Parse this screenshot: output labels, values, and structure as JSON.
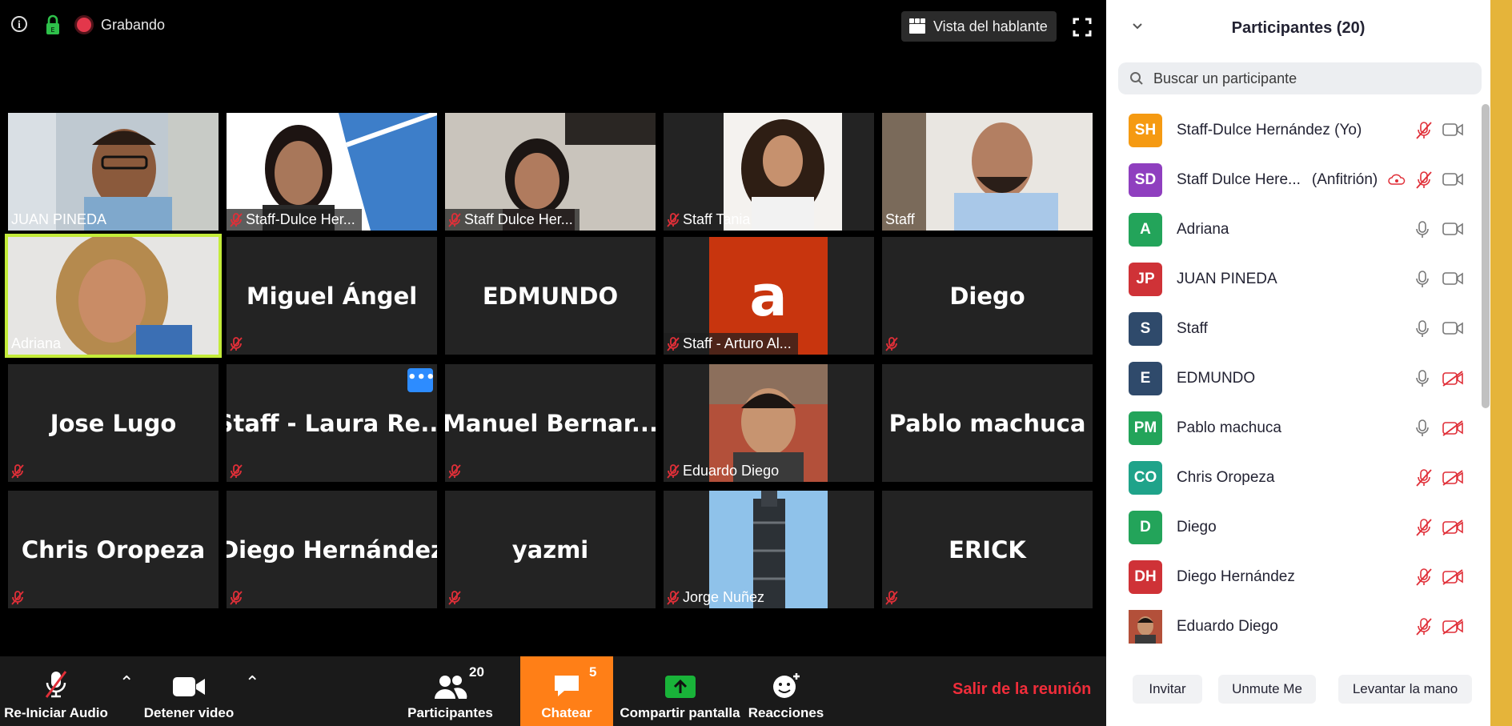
{
  "topbar": {
    "recording_label": "Grabando",
    "view_label": "Vista del hablante"
  },
  "tiles": [
    {
      "name": "JUAN PINEDA",
      "video": true,
      "muted": false
    },
    {
      "name": "Staff-Dulce Her...",
      "video": true,
      "muted": true
    },
    {
      "name": "Staff Dulce Her...",
      "video": true,
      "muted": true
    },
    {
      "name": "Staff Tania",
      "video": true,
      "muted": true
    },
    {
      "name": "Staff",
      "video": true,
      "muted": false
    },
    {
      "name": "Adriana",
      "video": true,
      "muted": false,
      "active": true
    },
    {
      "name": "Miguel Ángel",
      "video": false,
      "muted": true
    },
    {
      "name": "EDMUNDO",
      "video": false,
      "muted": false
    },
    {
      "name": "Staff - Arturo Al...",
      "video": false,
      "muted": true,
      "avatar_letter": "a"
    },
    {
      "name": "Diego",
      "video": false,
      "muted": true
    },
    {
      "name": "Jose Lugo",
      "video": false,
      "muted": true
    },
    {
      "name": "Staff  -  Laura Re...",
      "video": false,
      "muted": true
    },
    {
      "name": "Manuel  Bernar...",
      "video": false,
      "muted": true
    },
    {
      "name": "Eduardo Diego",
      "video": false,
      "muted": true
    },
    {
      "name": "Pablo machuca",
      "video": false,
      "muted": false
    },
    {
      "name": "Chris Oropeza",
      "video": false,
      "muted": true
    },
    {
      "name": "Diego Hernández",
      "video": false,
      "muted": true
    },
    {
      "name": "yazmi",
      "video": false,
      "muted": true
    },
    {
      "name": "Jorge Nuñez",
      "video": false,
      "muted": true
    },
    {
      "name": "ERICK",
      "video": false,
      "muted": true
    }
  ],
  "more_options_glyph": "•••",
  "toolbar": {
    "audio_label": "Re-Iniciar Audio",
    "video_label": "Detener video",
    "participants_label": "Participantes",
    "participants_count": "20",
    "chat_label": "Chatear",
    "chat_count": "5",
    "share_label": "Compartir pantalla",
    "reactions_label": "Reacciones",
    "leave_label": "Salir de la reunión"
  },
  "panel": {
    "title": "Participantes (20)",
    "search_placeholder": "Buscar un participante",
    "participants": [
      {
        "initials": "SH",
        "name": "Staff-Dulce Hernández (Yo)",
        "color": "#f59a12",
        "mic": "muted",
        "cam": "on"
      },
      {
        "initials": "SD",
        "name": "Staff Dulce Here...",
        "role": "(Anfitrión)",
        "color": "#8f3fbf",
        "mic": "muted",
        "cam": "on",
        "recording": true
      },
      {
        "initials": "A",
        "name": "Adriana",
        "color": "#23a45a",
        "mic": "on",
        "cam": "on"
      },
      {
        "initials": "JP",
        "name": "JUAN PINEDA",
        "color": "#cf3237",
        "mic": "on",
        "cam": "on"
      },
      {
        "initials": "S",
        "name": "Staff",
        "color": "#2f4a6b",
        "mic": "on",
        "cam": "on"
      },
      {
        "initials": "E",
        "name": "EDMUNDO",
        "color": "#2f4a6b",
        "mic": "on",
        "cam": "off"
      },
      {
        "initials": "PM",
        "name": "Pablo machuca",
        "color": "#23a45a",
        "mic": "on",
        "cam": "off"
      },
      {
        "initials": "CO",
        "name": "Chris Oropeza",
        "color": "#1fa38a",
        "mic": "muted",
        "cam": "off"
      },
      {
        "initials": "D",
        "name": "Diego",
        "color": "#23a45a",
        "mic": "muted",
        "cam": "off"
      },
      {
        "initials": "DH",
        "name": "Diego Hernández",
        "color": "#cf3237",
        "mic": "muted",
        "cam": "off"
      },
      {
        "initials": "",
        "name": "Eduardo Diego",
        "color": "#6a7a86",
        "mic": "muted",
        "cam": "off",
        "photo": true
      }
    ],
    "invite_label": "Invitar",
    "unmute_label": "Unmute Me",
    "raise_hand_label": "Levantar la mano"
  },
  "colors": {
    "accent_orange": "#ff7f17",
    "leave_red": "#f02d3a",
    "muted_red": "#e02f38",
    "active_speaker": "#c4ec3a",
    "frame_yellow": "#e5b43a"
  }
}
